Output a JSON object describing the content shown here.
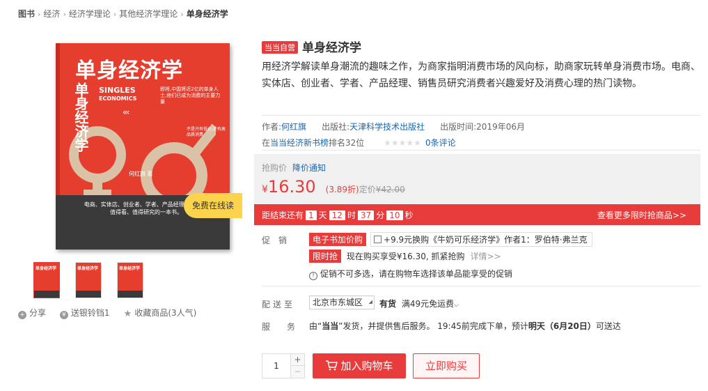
{
  "breadcrumb": {
    "items": [
      "图书",
      "经济",
      "经济学理论",
      "其他经济学理论",
      "单身经济学"
    ]
  },
  "cover": {
    "title": "单身经济学",
    "vertical": "单身经济学",
    "english_1": "SINGLES",
    "english_2": "ECONOMICS",
    "arrows": "‹‹‹",
    "blurb": "即将,中国将近2亿的单身人士,他们已成为消费的主要力量",
    "blurb2": "不是只有低价,还有高品质消费",
    "author": "何红旗 著",
    "bottom_text_1": "电商、实体店、创业者、学者、产品经理、销售员,",
    "bottom_text_2": "值得看、值得研究的一本书。",
    "free_read": "免费在线读"
  },
  "thumbs": [
    {
      "label": "单身经济学"
    },
    {
      "label": "单身经济学"
    },
    {
      "label": "单身经济学"
    }
  ],
  "share": {
    "share_label": "分享",
    "gift_label": "送银铃铛1",
    "fav_label": "收藏商品(3人气)"
  },
  "product": {
    "badge": "当当自营",
    "title": "单身经济学",
    "subtitle": "用经济学解读单身潮流的趣味之作，为商家指明消费市场的风向标，助商家玩转单身消费市场。电商、实体店、创业者、学者、产品经理、销售员研究消费者兴趣爱好及消费心理的热门读物。",
    "author_label": "作者:",
    "author": "何红旗",
    "publisher_label": "出版社:",
    "publisher": "天津科学技术出版社",
    "pubdate_label": "出版时间:",
    "pubdate": "2019年06月",
    "rank_prefix": "在",
    "rank_link": "当当经济新书榜",
    "rank_suffix": "排名32位",
    "stars": "★★★★★",
    "comments": "0条评论"
  },
  "price": {
    "label": "抢购价",
    "notice": "降价通知",
    "yen": "¥",
    "amount": "16.30",
    "discount": "(3.89折)",
    "orig_label": "定价",
    "orig": "¥42.00"
  },
  "flash": {
    "prefix": "距结束还有",
    "days": "1",
    "days_unit": "天",
    "hours": "12",
    "hours_unit": "时",
    "minutes": "37",
    "minutes_unit": "分",
    "seconds": "10",
    "seconds_unit": "秒",
    "more": "查看更多限时抢商品>>"
  },
  "promo": {
    "label": "促销",
    "tag1": "电子书加价购",
    "ebook_text": "+9.9元换购《牛奶可乐经济学》作者1：罗伯特·弗兰克",
    "tag2": "限时抢",
    "tag2_text": "现在购买享受¥16.30, 抓紧抢购",
    "detail": "详情>>",
    "note": "促销不可多选，请在购物车选择该单品能享受的促销"
  },
  "delivery": {
    "label": "配送至",
    "address": "北京市东城区",
    "stock": "有货",
    "shipping": "满49元免运费"
  },
  "service": {
    "label": "服务",
    "text_1": "由“",
    "seller": "当当",
    "text_2": "”发货，并提供售后服务。 19:45前完成下单，预计",
    "eta": "明天（6月20日）",
    "text_3": "可送达"
  },
  "buy": {
    "qty": "1",
    "plus": "+",
    "minus": "−",
    "cart": "加入购物车",
    "buy_now": "立即购买"
  },
  "colors": {
    "accent": "#e83b3b",
    "link": "#1a66b3",
    "cover": "#e53d2e",
    "badge_yellow": "#fcd34d"
  }
}
